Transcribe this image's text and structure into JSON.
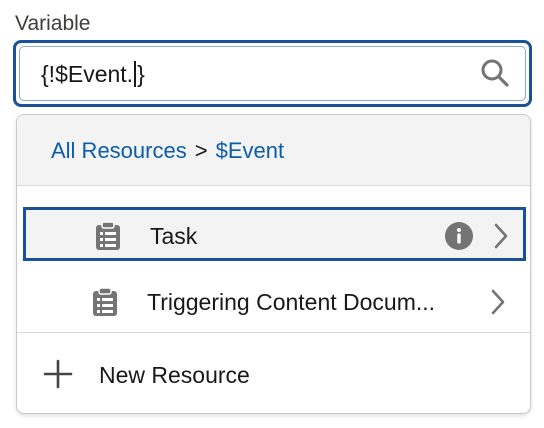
{
  "field": {
    "label": "Variable",
    "value_before_caret": "{!$Event.",
    "value_after_caret": "}"
  },
  "breadcrumb": {
    "root": "All Resources",
    "separator": ">",
    "current": "$Event"
  },
  "items": [
    {
      "label": "Task",
      "icon": "clipboard-icon",
      "has_info": true,
      "selected": true
    },
    {
      "label": "Triggering Content Docum...",
      "icon": "clipboard-icon",
      "has_info": false,
      "selected": false
    }
  ],
  "new_resource": {
    "label": "New Resource",
    "icon": "plus-icon"
  },
  "colors": {
    "focus_border": "#1b5297",
    "link": "#0b5cab",
    "icon_gray": "#747474"
  }
}
